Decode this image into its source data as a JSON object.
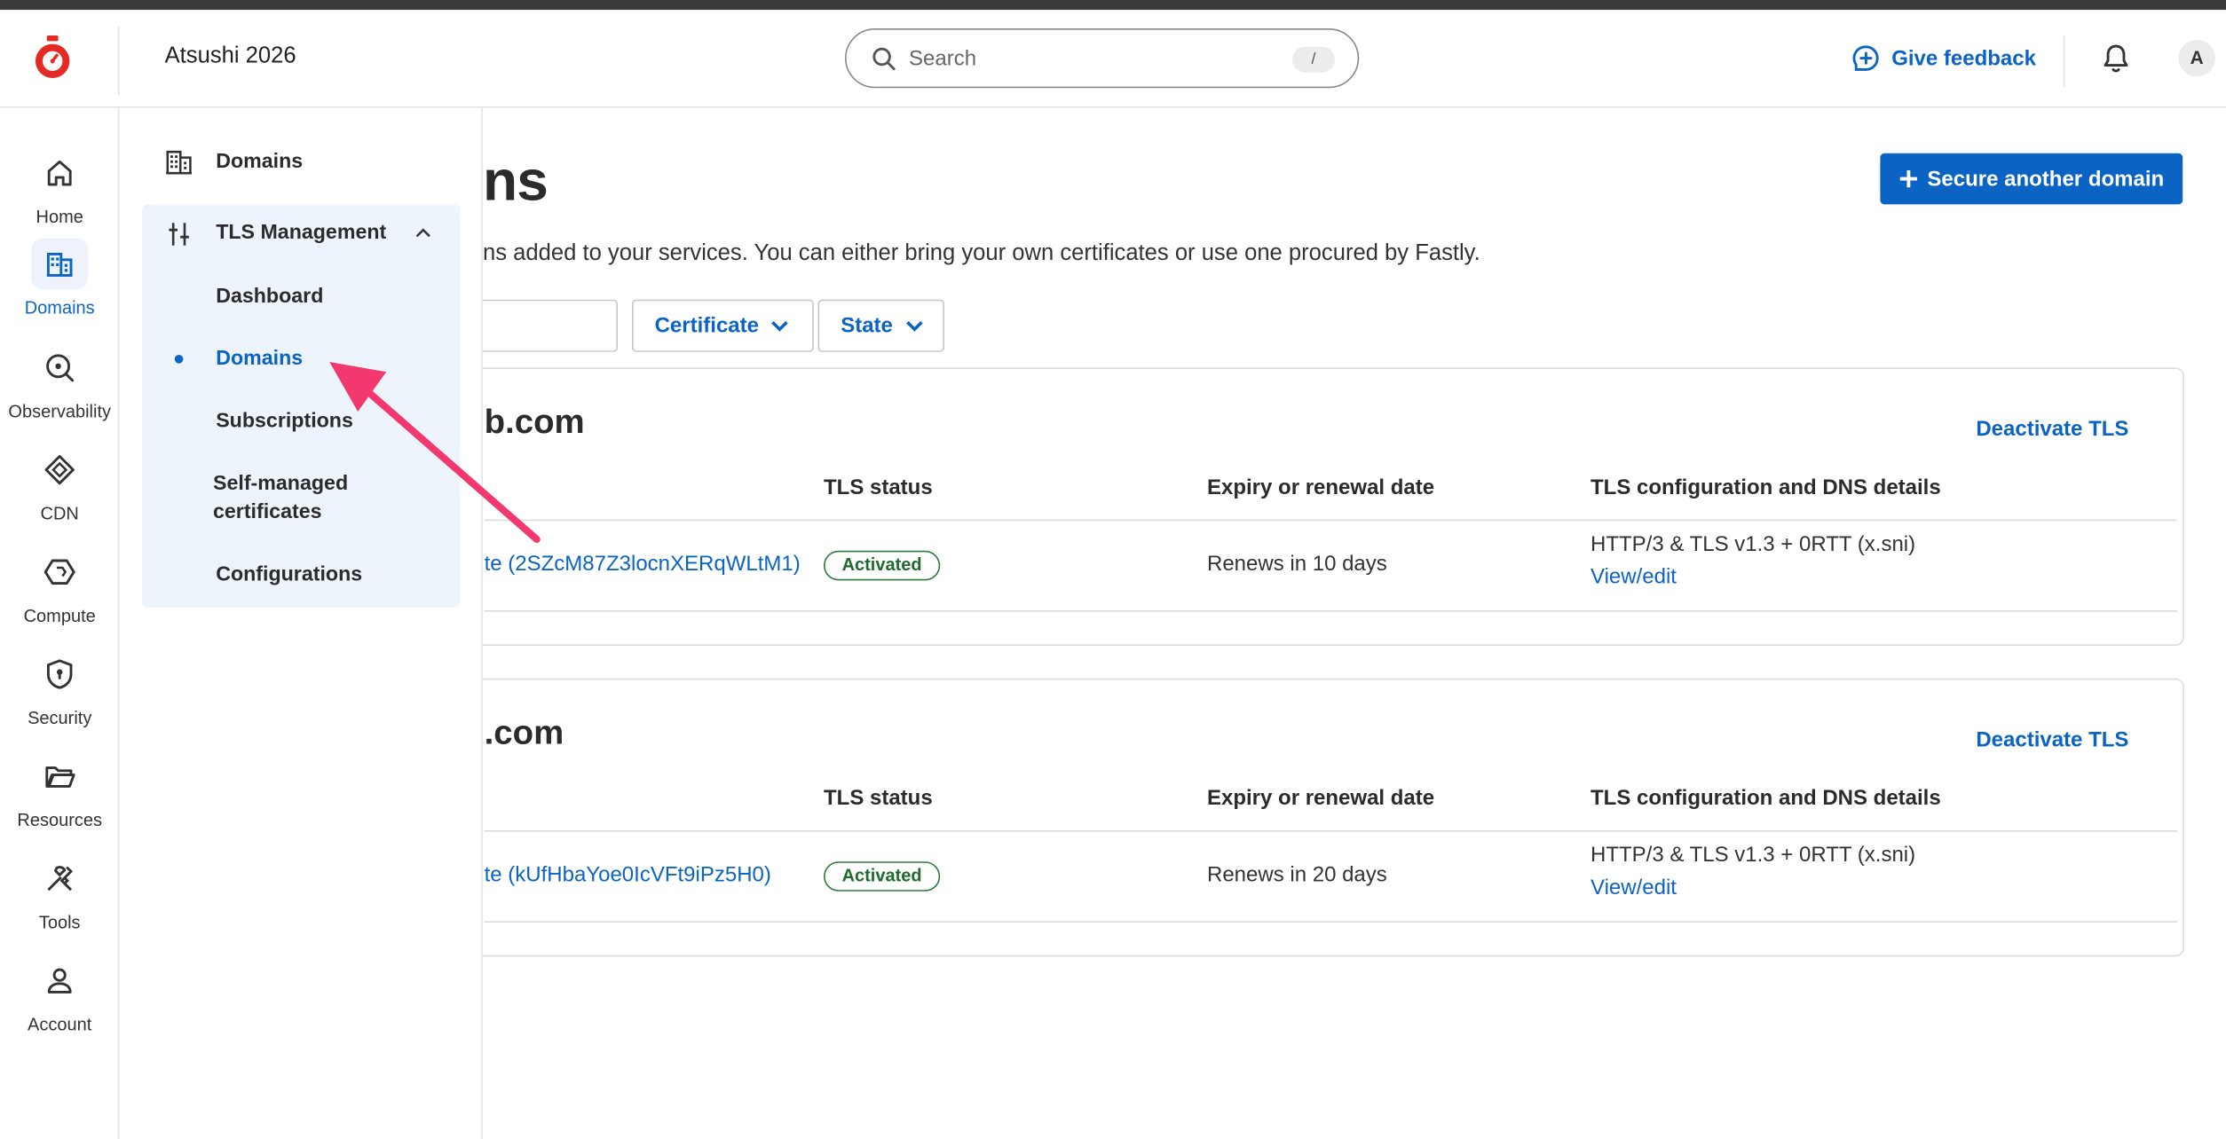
{
  "header": {
    "org_name": "Atsushi 2026",
    "search_placeholder": "Search",
    "search_shortcut": "/",
    "feedback_label": "Give feedback",
    "avatar_initial": "A"
  },
  "rail": {
    "items": [
      {
        "label": "Home",
        "icon": "home-icon"
      },
      {
        "label": "Domains",
        "icon": "domains-icon"
      },
      {
        "label": "Observability",
        "icon": "observability-icon"
      },
      {
        "label": "CDN",
        "icon": "cdn-icon"
      },
      {
        "label": "Compute",
        "icon": "compute-icon"
      },
      {
        "label": "Security",
        "icon": "security-icon"
      },
      {
        "label": "Resources",
        "icon": "folder-icon"
      },
      {
        "label": "Tools",
        "icon": "tools-icon"
      },
      {
        "label": "Account",
        "icon": "account-icon"
      }
    ],
    "active": "Domains"
  },
  "flyout": {
    "domains_label": "Domains",
    "tls_label": "TLS Management",
    "sub_items": [
      "Dashboard",
      "Domains",
      "Subscriptions",
      "Self-managed",
      "certificates",
      "Configurations"
    ],
    "active_sub": "Domains"
  },
  "main": {
    "title_fragment": "ns",
    "description": "ns added to your services. You can either bring your own certificates or use one procured by Fastly.",
    "primary_button": "Secure another domain",
    "filters": {
      "certificate": "Certificate",
      "state": "State"
    },
    "table_headers": [
      "TLS status",
      "Expiry or renewal date",
      "TLS configuration and DNS details"
    ],
    "cards": [
      {
        "name_fragment": "b.com",
        "deactivate": "Deactivate TLS",
        "cert_link": "te (2SZcM87Z3locnXERqWLtM1)",
        "status": "Activated",
        "renewal": "Renews in 10 days",
        "tls_config": "HTTP/3 & TLS v1.3 + 0RTT (x.sni)",
        "view_edit": "View/edit"
      },
      {
        "name_fragment": ".com",
        "deactivate": "Deactivate TLS",
        "cert_link": "te (kUfHbaYoe0IcVFt9iPz5H0)",
        "status": "Activated",
        "renewal": "Renews in 20 days",
        "tls_config": "HTTP/3 & TLS v1.3 + 0RTT (x.sni)",
        "view_edit": "View/edit"
      }
    ]
  },
  "colors": {
    "accent": "#0b64c4",
    "annotation_arrow": "#f2386e",
    "status_green": "#1f6b2e"
  }
}
